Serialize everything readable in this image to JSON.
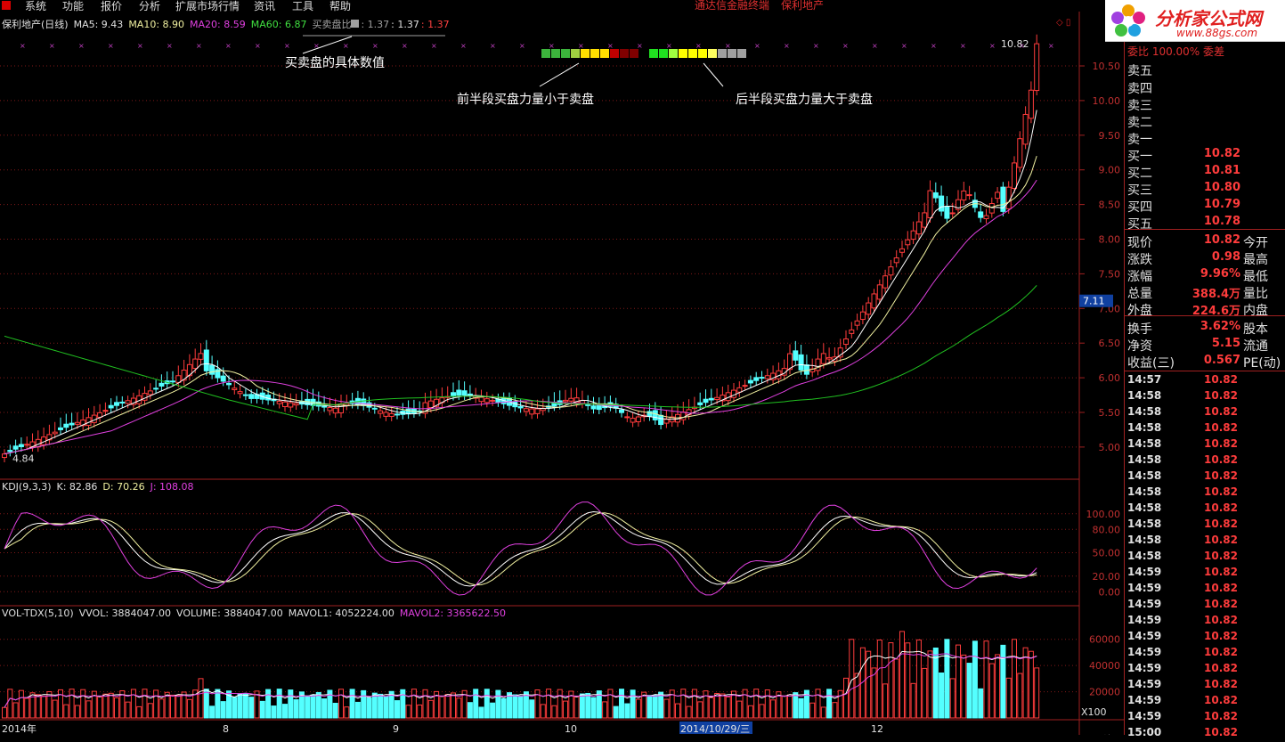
{
  "menu": {
    "items": [
      "系统",
      "功能",
      "报价",
      "分析",
      "扩展市场行情",
      "资讯",
      "工具",
      "帮助"
    ],
    "brand_left": "通达信金融终端",
    "brand_right": "保利地产"
  },
  "watermark": {
    "title": "分析家公式网",
    "url": "www.88gs.com"
  },
  "main_legend": {
    "title": "保利地产(日线)",
    "ma5": "MA5: 9.43",
    "ma10": "MA10: 8.90",
    "ma20": "MA20: 8.59",
    "ma60": "MA60: 6.87",
    "ratio_label": "买卖盘比",
    "ratio_v1": ": 1.37",
    "ratio_v2": ": 1.37",
    "ratio_v3": ": 1.37"
  },
  "annotations": {
    "a1": "买卖盘的具体数值",
    "a2": "前半段买盘力量小于卖盘",
    "a3": "后半段买盘力量大于卖盘"
  },
  "bar_strips": {
    "left": [
      "#3cb43c",
      "#3cb43c",
      "#3cb43c",
      "#a0d040",
      "#ffe000",
      "#ffe000",
      "#ffe000",
      "#c00000",
      "#800000",
      "#800000"
    ],
    "right": [
      "#20e020",
      "#20e020",
      "#a0ff40",
      "#ffff00",
      "#ffff00",
      "#ffff00",
      "#ffff60",
      "#a0a0a0",
      "#a0a0a0",
      "#a0a0a0"
    ]
  },
  "price_axis": {
    "labels": [
      "10.50",
      "10.00",
      "9.50",
      "9.00",
      "8.50",
      "8.00",
      "7.50",
      "7.00",
      "6.50",
      "6.00",
      "5.50",
      "5.00"
    ],
    "current_marker": "7.11",
    "high_label": "10.82",
    "low_label": "4.84"
  },
  "kdj_legend": {
    "name": "KDJ(9,3,3)",
    "k": "K: 82.86",
    "d": "D: 70.26",
    "j": "J: 108.08"
  },
  "kdj_axis": [
    "100.00",
    "80.00",
    "50.00",
    "20.00",
    "0.00"
  ],
  "vol_legend": {
    "name": "VOL-TDX(5,10)",
    "vvol": "VVOL: 3884047.00",
    "volume": "VOLUME: 3884047.00",
    "mavol1": "MAVOL1: 4052224.00",
    "mavol2": "MAVOL2: 3365622.50"
  },
  "vol_axis": [
    "60000",
    "40000",
    "20000"
  ],
  "vol_unit": "X100",
  "x_axis": {
    "labels": [
      "2014年",
      "8",
      "9",
      "10",
      "2014/10/29/三",
      "12"
    ],
    "period": "日线"
  },
  "quote_panel": {
    "top_row": "委比  100.00%  委差",
    "sell": [
      {
        "label": "卖五",
        "value": ""
      },
      {
        "label": "卖四",
        "value": ""
      },
      {
        "label": "卖三",
        "value": ""
      },
      {
        "label": "卖二",
        "value": ""
      },
      {
        "label": "卖一",
        "value": ""
      }
    ],
    "buy": [
      {
        "label": "买一",
        "value": "10.82"
      },
      {
        "label": "买二",
        "value": "10.81"
      },
      {
        "label": "买三",
        "value": "10.80"
      },
      {
        "label": "买四",
        "value": "10.79"
      },
      {
        "label": "买五",
        "value": "10.78"
      }
    ],
    "stats": [
      {
        "label": "现价",
        "value": "10.82",
        "label2": "今开"
      },
      {
        "label": "涨跌",
        "value": "0.98",
        "label2": "最高"
      },
      {
        "label": "涨幅",
        "value": "9.96%",
        "label2": "最低"
      },
      {
        "label": "总量",
        "value": "388.4万",
        "label2": "量比"
      },
      {
        "label": "外盘",
        "value": "224.6万",
        "label2": "内盘"
      }
    ],
    "stats2": [
      {
        "label": "换手",
        "value": "3.62%",
        "label2": "股本"
      },
      {
        "label": "净资",
        "value": "5.15",
        "label2": "流通"
      },
      {
        "label": "收益(三)",
        "value": "0.567",
        "label2": "PE(动)"
      }
    ],
    "ticks": [
      {
        "t": "14:57",
        "p": "10.82"
      },
      {
        "t": "14:58",
        "p": "10.82"
      },
      {
        "t": "14:58",
        "p": "10.82"
      },
      {
        "t": "14:58",
        "p": "10.82"
      },
      {
        "t": "14:58",
        "p": "10.82"
      },
      {
        "t": "14:58",
        "p": "10.82"
      },
      {
        "t": "14:58",
        "p": "10.82"
      },
      {
        "t": "14:58",
        "p": "10.82"
      },
      {
        "t": "14:58",
        "p": "10.82"
      },
      {
        "t": "14:58",
        "p": "10.82"
      },
      {
        "t": "14:58",
        "p": "10.82"
      },
      {
        "t": "14:58",
        "p": "10.82"
      },
      {
        "t": "14:59",
        "p": "10.82"
      },
      {
        "t": "14:59",
        "p": "10.82"
      },
      {
        "t": "14:59",
        "p": "10.82"
      },
      {
        "t": "14:59",
        "p": "10.82"
      },
      {
        "t": "14:59",
        "p": "10.82"
      },
      {
        "t": "14:59",
        "p": "10.82"
      },
      {
        "t": "14:59",
        "p": "10.82"
      },
      {
        "t": "14:59",
        "p": "10.82"
      },
      {
        "t": "14:59",
        "p": "10.82"
      },
      {
        "t": "14:59",
        "p": "10.82"
      },
      {
        "t": "15:00",
        "p": "10.82"
      }
    ]
  }
}
